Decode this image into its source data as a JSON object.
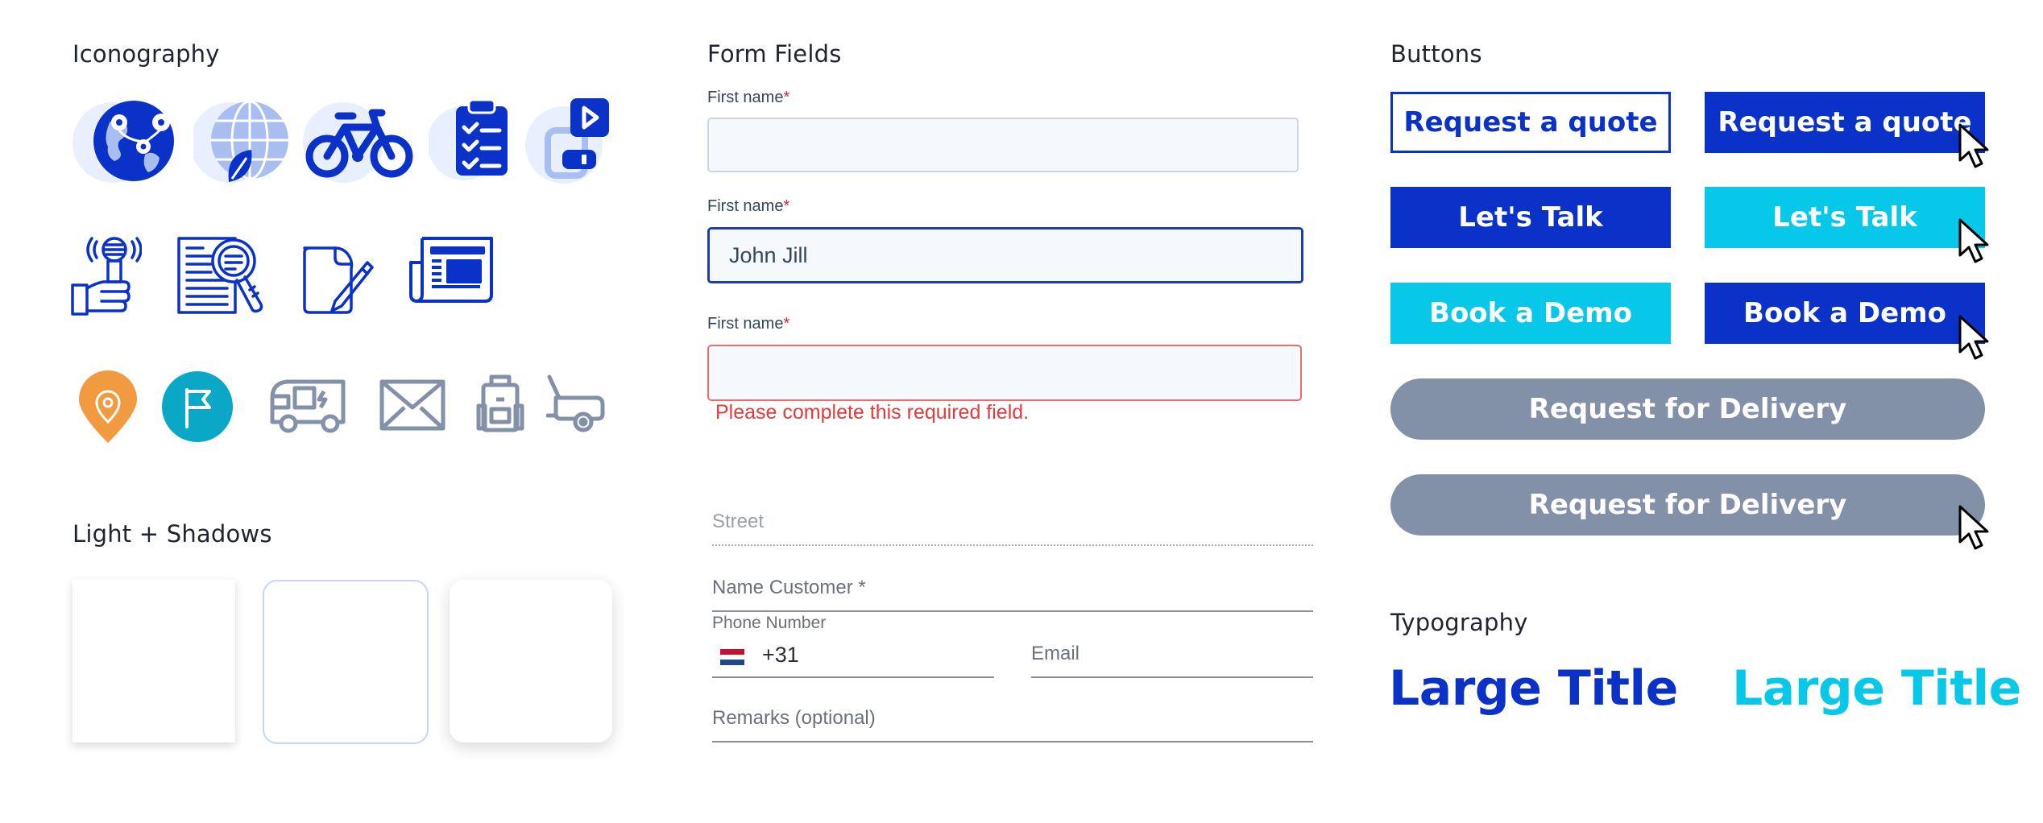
{
  "sections": {
    "iconography": "Iconography",
    "form_fields": "Form Fields",
    "buttons": "Buttons",
    "light_shadows": "Light + Shadows",
    "typography": "Typography"
  },
  "colors": {
    "primary_blue": "#0a31c8",
    "cyan": "#08c8ea",
    "grey": "#8290a8",
    "light_blue": "#a8bdf0",
    "orange": "#f29a3f",
    "teal": "#0aa7c6",
    "error": "#e23b3b"
  },
  "icons": [
    "globe-pins-icon",
    "globe-leaf-icon",
    "bicycle-icon",
    "clipboard-checklist-icon",
    "media-device-icon",
    "podcast-microphone-icon",
    "document-search-icon",
    "document-edit-icon",
    "newspaper-icon",
    "location-pin-icon",
    "flag-icon",
    "delivery-van-icon",
    "envelope-icon",
    "backpack-icon",
    "trailer-icon"
  ],
  "form": {
    "field1": {
      "label": "First name",
      "required_mark": "*",
      "value": ""
    },
    "field2": {
      "label": "First name",
      "required_mark": "*",
      "value": "John Jill"
    },
    "field3": {
      "label": "First name",
      "required_mark": "*",
      "value": "",
      "error": "Please complete this required field."
    },
    "street": {
      "placeholder": "Street"
    },
    "name_customer": {
      "placeholder": "Name Customer *"
    },
    "phone": {
      "label": "Phone Number",
      "value": "+31"
    },
    "email": {
      "placeholder": "Email"
    },
    "remarks": {
      "placeholder": "Remarks (optional)"
    }
  },
  "buttons": {
    "quote_outline": "Request a quote",
    "quote_hover": "Request a quote",
    "talk": "Let's Talk",
    "talk_hover": "Let's Talk",
    "demo": "Book a Demo",
    "demo_hover": "Book a Demo",
    "delivery": "Request for Delivery",
    "delivery_hover": "Request for Delivery"
  },
  "typography": {
    "large_title_blue": "Large Title",
    "large_title_cyan": "Large Title"
  }
}
